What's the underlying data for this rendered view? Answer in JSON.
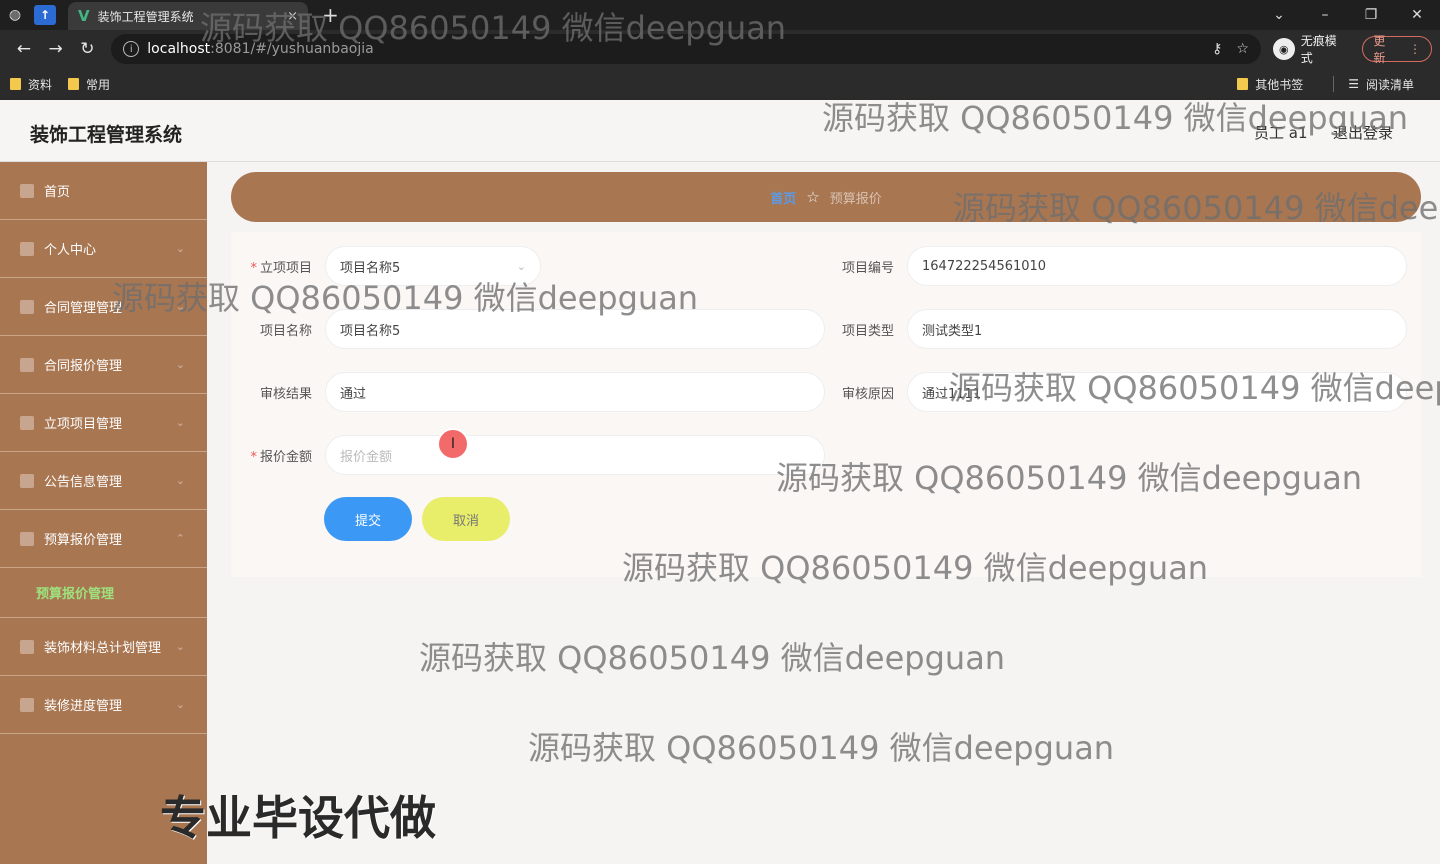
{
  "browser": {
    "tab_title": "装饰工程管理系统",
    "tab_close": "×",
    "new_tab": "+",
    "url_host": "localhost",
    "url_path": ":8081/#/yushuanbaojia",
    "incognito_label": "无痕模式",
    "update_label": "更新",
    "bookmarks": [
      "资料",
      "常用"
    ],
    "bookmarks_right": [
      "其他书签",
      "阅读清单"
    ]
  },
  "header": {
    "title": "装饰工程管理系统",
    "user": "员工 a1",
    "logout": "退出登录"
  },
  "sidebar": {
    "items": [
      "首页",
      "个人中心",
      "合同管理管理",
      "合同报价管理",
      "立项项目管理",
      "公告信息管理",
      "预算报价管理"
    ],
    "active_sub": "预算报价管理",
    "items_after": [
      "装饰材料总计划管理",
      "装修进度管理"
    ]
  },
  "breadcrumb": {
    "home": "首页",
    "current": "预算报价"
  },
  "form": {
    "project_label": "立项项目",
    "project_value": "项目名称5",
    "code_label": "项目编号",
    "code_value": "164722254561010",
    "name_label": "项目名称",
    "name_value": "项目名称5",
    "type_label": "项目类型",
    "type_value": "测试类型1",
    "result_label": "审核结果",
    "result_value": "通过",
    "reason_label": "审核原因",
    "reason_value": "通过1111",
    "amount_label": "报价金额",
    "amount_placeholder": "报价金额",
    "submit": "提交",
    "cancel": "取消"
  },
  "watermark": {
    "text": "源码获取 QQ86050149 微信deepguan",
    "text_cut": "源码获取 QQ86050149 微信deepgu",
    "big": "专业毕设代做"
  }
}
